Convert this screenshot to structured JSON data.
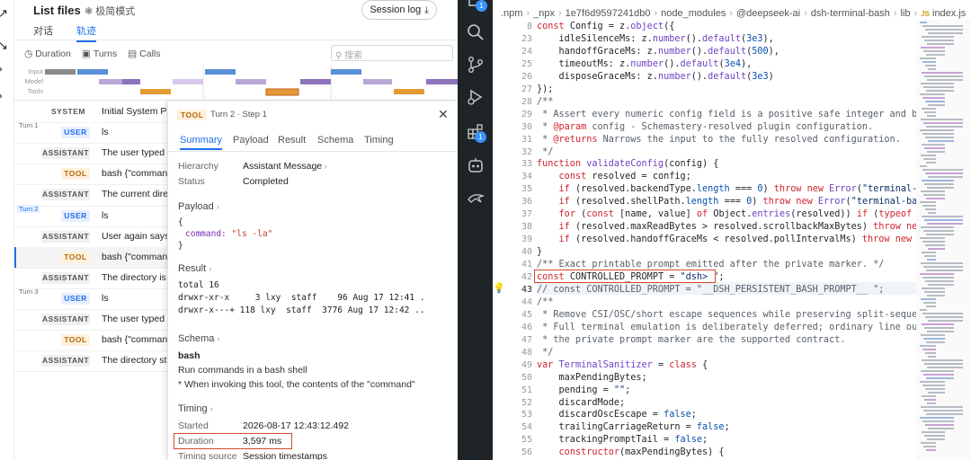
{
  "left": {
    "title": "List files",
    "lite_mode": "极简模式",
    "session_log": "Session log",
    "view_tabs": [
      "对话",
      "轨迹"
    ],
    "filters": [
      "Duration",
      "Turns",
      "Calls"
    ],
    "search_placeholder": "搜索",
    "timeline_labels": [
      "Input",
      "Model",
      "Tools"
    ],
    "rows": [
      {
        "role": "SYSTEM",
        "kind": "sys",
        "text": "Initial System Pro",
        "turn": ""
      },
      {
        "role": "USER",
        "kind": "user",
        "text": "ls",
        "turn": "Turn 1"
      },
      {
        "role": "ASSISTANT",
        "kind": "asst",
        "text": "The user typed \"",
        "turn": ""
      },
      {
        "role": "TOOL",
        "kind": "tool",
        "text": "bash  {\"comman",
        "turn": ""
      },
      {
        "role": "ASSISTANT",
        "kind": "asst",
        "text": "The current direc",
        "turn": ""
      },
      {
        "role": "USER",
        "kind": "user",
        "text": "ls",
        "turn": "Turn 2"
      },
      {
        "role": "ASSISTANT",
        "kind": "asst",
        "text": "User again says \"",
        "turn": ""
      },
      {
        "role": "TOOL",
        "kind": "tool",
        "text": "bash  {\"comman",
        "turn": ""
      },
      {
        "role": "ASSISTANT",
        "kind": "asst",
        "text": "The directory is s",
        "turn": ""
      },
      {
        "role": "USER",
        "kind": "user",
        "text": "ls",
        "turn": "Turn 3"
      },
      {
        "role": "ASSISTANT",
        "kind": "asst",
        "text": "The user typed \"",
        "turn": ""
      },
      {
        "role": "TOOL",
        "kind": "tool",
        "text": "bash  {\"comman",
        "turn": ""
      },
      {
        "role": "ASSISTANT",
        "kind": "asst",
        "text": "The directory stil",
        "turn": ""
      }
    ]
  },
  "panel": {
    "badge": "TOOL",
    "step": "Turn 2 · Step 1",
    "tabs": [
      "Summary",
      "Payload",
      "Result",
      "Schema",
      "Timing"
    ],
    "hierarchy_label": "Hierarchy",
    "hierarchy_value": "Assistant Message",
    "status_label": "Status",
    "status_value": "Completed",
    "payload_title": "Payload",
    "payload_open": "{",
    "payload_key": "command:",
    "payload_val": "\"ls -la\"",
    "payload_close": "}",
    "result_title": "Result",
    "result_lines": [
      "total 16",
      "drwxr-xr-x     3 lxy  staff    96 Aug 17 12:41 .",
      "drwxr-x---+ 118 lxy  staff  3776 Aug 17 12:42 .."
    ],
    "schema_title": "Schema",
    "schema_name": "bash",
    "schema_desc": "Run commands in a bash shell",
    "schema_note": "* When invoking this tool, the contents of the \"command\"",
    "timing_title": "Timing",
    "started_label": "Started",
    "started_value": "2026-08-17 12:43:12.492",
    "duration_label": "Duration",
    "duration_value": "3,597 ms",
    "source_label": "Timing source",
    "source_value": "Session timestamps"
  },
  "editor": {
    "crumbs": [
      ".npm",
      "_npx",
      "1e7f6d9597241db0",
      "node_modules",
      "@deepseek-ai",
      "dsh-terminal-bash",
      "lib",
      "index.js"
    ],
    "scm_badge": "1",
    "ext_badge": "1",
    "account_badge": "1",
    "line_numbers": [
      8,
      23,
      24,
      25,
      26,
      27,
      28,
      29,
      30,
      31,
      32,
      33,
      34,
      35,
      36,
      37,
      38,
      39,
      40,
      41,
      42,
      43,
      44,
      45,
      46,
      47,
      48,
      49,
      50,
      51,
      52,
      53,
      54,
      55,
      56
    ],
    "lines": [
      [
        [
          "kw",
          "const "
        ],
        [
          "",
          "Config = z."
        ],
        [
          "fn",
          "object"
        ],
        [
          "",
          "({"
        ]
      ],
      [
        [
          "",
          "    idleSilenceMs: z."
        ],
        [
          "fn",
          "number"
        ],
        [
          "",
          "()."
        ],
        [
          "fn",
          "default"
        ],
        [
          "",
          "("
        ],
        [
          "nm",
          "3e3"
        ],
        [
          "",
          "),"
        ]
      ],
      [
        [
          "",
          "    handoffGraceMs: z."
        ],
        [
          "fn",
          "number"
        ],
        [
          "",
          "()."
        ],
        [
          "fn",
          "default"
        ],
        [
          "",
          "("
        ],
        [
          "nm",
          "500"
        ],
        [
          "",
          "),"
        ]
      ],
      [
        [
          "",
          "    timeoutMs: z."
        ],
        [
          "fn",
          "number"
        ],
        [
          "",
          "()."
        ],
        [
          "fn",
          "default"
        ],
        [
          "",
          "("
        ],
        [
          "nm",
          "3e4"
        ],
        [
          "",
          "),"
        ]
      ],
      [
        [
          "",
          "    disposeGraceMs: z."
        ],
        [
          "fn",
          "number"
        ],
        [
          "",
          "()."
        ],
        [
          "fn",
          "default"
        ],
        [
          "",
          "("
        ],
        [
          "nm",
          "3e3"
        ],
        [
          "",
          ")"
        ]
      ],
      [
        [
          "",
          "});"
        ]
      ],
      [
        [
          "cm",
          "/**"
        ]
      ],
      [
        [
          "cm",
          " * Assert every numeric config field is a positive safe integer and bounds co"
        ]
      ],
      [
        [
          "cm",
          " * "
        ],
        [
          "kw",
          "@param"
        ],
        [
          "cm",
          " config - Schemastery-resolved plugin configuration."
        ]
      ],
      [
        [
          "cm",
          " * "
        ],
        [
          "kw",
          "@returns"
        ],
        [
          "cm",
          " Narrows the input to the fully resolved configuration."
        ]
      ],
      [
        [
          "cm",
          " */"
        ]
      ],
      [
        [
          "kw",
          "function "
        ],
        [
          "fn",
          "validateConfig"
        ],
        [
          "",
          "(config) {"
        ]
      ],
      [
        [
          "",
          "    "
        ],
        [
          "kw",
          "const "
        ],
        [
          "",
          "resolved = config;"
        ]
      ],
      [
        [
          "",
          "    "
        ],
        [
          "kw",
          "if "
        ],
        [
          "",
          "(resolved.backendType."
        ],
        [
          "pr",
          "length"
        ],
        [
          "",
          " === "
        ],
        [
          "nm",
          "0"
        ],
        [
          "",
          ") "
        ],
        [
          "th",
          "throw new "
        ],
        [
          "fn",
          "Error"
        ],
        [
          "",
          "("
        ],
        [
          "st",
          "\"terminal-bash: b"
        ]
      ],
      [
        [
          "",
          "    "
        ],
        [
          "kw",
          "if "
        ],
        [
          "",
          "(resolved.shellPath."
        ],
        [
          "pr",
          "length"
        ],
        [
          "",
          " === "
        ],
        [
          "nm",
          "0"
        ],
        [
          "",
          ") "
        ],
        [
          "th",
          "throw new "
        ],
        [
          "fn",
          "Error"
        ],
        [
          "",
          "("
        ],
        [
          "st",
          "\"terminal-bash: she"
        ]
      ],
      [
        [
          "",
          "    "
        ],
        [
          "kw",
          "for "
        ],
        [
          "",
          "("
        ],
        [
          "kw",
          "const "
        ],
        [
          "",
          "[name, value] "
        ],
        [
          "kw",
          "of "
        ],
        [
          "",
          "Object."
        ],
        [
          "fn",
          "entries"
        ],
        [
          "",
          "(resolved)) "
        ],
        [
          "kw",
          "if "
        ],
        [
          "",
          "("
        ],
        [
          "kw",
          "typeof "
        ],
        [
          "",
          "value ="
        ]
      ],
      [
        [
          "",
          "    "
        ],
        [
          "kw",
          "if "
        ],
        [
          "",
          "(resolved.maxReadBytes > resolved.scrollbackMaxBytes) "
        ],
        [
          "th",
          "throw new "
        ],
        [
          "fn",
          "Error"
        ]
      ],
      [
        [
          "",
          "    "
        ],
        [
          "kw",
          "if "
        ],
        [
          "",
          "(resolved.handoffGraceMs < resolved.pollIntervalMs) "
        ],
        [
          "th",
          "throw new "
        ],
        [
          "fn",
          "Error"
        ],
        [
          "",
          "(\""
        ]
      ],
      [
        [
          "",
          "}"
        ]
      ],
      [
        [
          "cm",
          "/** Exact printable prompt emitted after the private marker. */"
        ]
      ],
      [
        [
          "kw",
          "const "
        ],
        [
          "",
          "CONTROLLED_PROMPT = "
        ],
        [
          "st",
          "\"dsh> \""
        ],
        [
          "",
          ";"
        ]
      ],
      [
        [
          "cm",
          "// const CONTROLLED_PROMPT = \"__DSH_PERSISTENT_BASH_PROMPT__ \";"
        ]
      ],
      [
        [
          "cm",
          "/**"
        ]
      ],
      [
        [
          "cm",
          " * Remove CSI/OSC/short escape sequences while preserving split-sequence carr"
        ]
      ],
      [
        [
          "cm",
          " * Full terminal emulation is deliberately deferred; ordinary line output and"
        ]
      ],
      [
        [
          "cm",
          " * the private prompt marker are the supported contract."
        ]
      ],
      [
        [
          "cm",
          " */"
        ]
      ],
      [
        [
          "kw",
          "var "
        ],
        [
          "fn",
          "TerminalSanitizer"
        ],
        [
          "",
          " = "
        ],
        [
          "kw",
          "class "
        ],
        [
          "",
          "{"
        ]
      ],
      [
        [
          "",
          "    maxPendingBytes;"
        ]
      ],
      [
        [
          "",
          "    pending = "
        ],
        [
          "st",
          "\"\""
        ],
        [
          "",
          ";"
        ]
      ],
      [
        [
          "",
          "    discardMode;"
        ]
      ],
      [
        [
          "",
          "    discardOscEscape = "
        ],
        [
          "nm",
          "false"
        ],
        [
          "",
          ";"
        ]
      ],
      [
        [
          "",
          "    trailingCarriageReturn = "
        ],
        [
          "nm",
          "false"
        ],
        [
          "",
          ";"
        ]
      ],
      [
        [
          "",
          "    trackingPromptTail = "
        ],
        [
          "nm",
          "false"
        ],
        [
          "",
          ";"
        ]
      ],
      [
        [
          "",
          "    "
        ],
        [
          "kw",
          "constructor"
        ],
        [
          "",
          "(maxPendingBytes) {"
        ]
      ]
    ]
  }
}
